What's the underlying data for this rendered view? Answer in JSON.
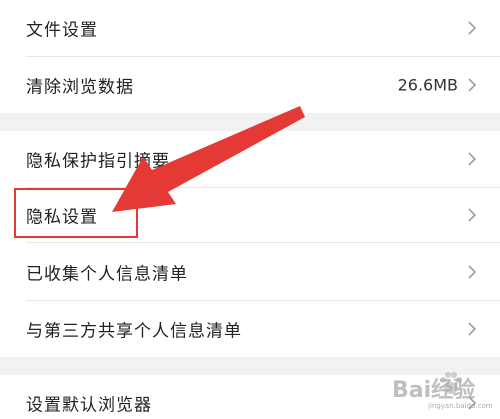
{
  "settings": {
    "file_settings_label": "文件设置",
    "clear_browsing_label": "清除浏览数据",
    "clear_browsing_value": "26.6MB",
    "privacy_guide_label": "隐私保护指引摘要",
    "privacy_settings_label": "隐私设置",
    "collected_info_label": "已收集个人信息清单",
    "third_party_label": "与第三方共享个人信息清单",
    "default_browser_label": "设置默认浏览器"
  },
  "annotation": {
    "arrow_color": "#e53935",
    "highlight_color": "#e53935"
  },
  "watermark": {
    "text": "Bai经验",
    "url": "jingyan.baidu.com"
  },
  "colors": {
    "background": "#ffffff",
    "section_gap": "#f2f2f2",
    "divider": "#e8e8e8",
    "text": "#222222",
    "chevron": "#9e9e9e"
  },
  "icons": {
    "chevron": "chevron-right-icon",
    "watermark_logo": "paw-icon"
  }
}
